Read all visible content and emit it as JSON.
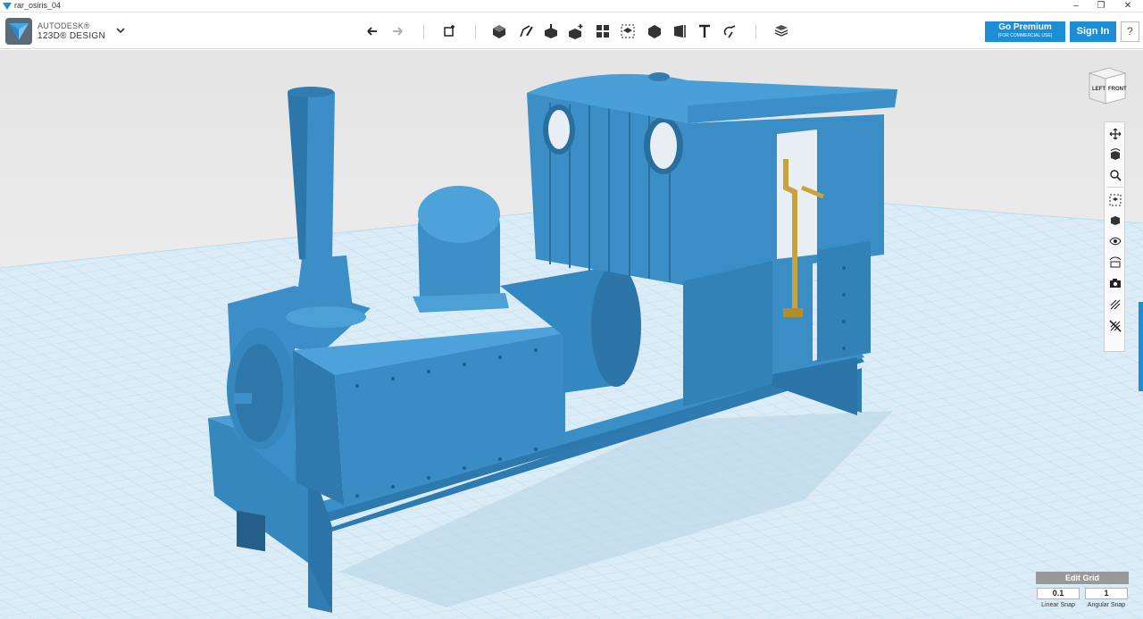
{
  "window": {
    "title": "rar_osiris_04",
    "controls": [
      "minimize",
      "maximize",
      "close"
    ]
  },
  "brand": {
    "company": "AUTODESK®",
    "product": "123D® DESIGN"
  },
  "toolbar": {
    "tools": [
      {
        "name": "undo-icon"
      },
      {
        "name": "redo-icon"
      },
      {
        "name": "transform-icon"
      },
      {
        "name": "primitives-icon"
      },
      {
        "name": "sketch-icon"
      },
      {
        "name": "construct-icon"
      },
      {
        "name": "modify-icon"
      },
      {
        "name": "pattern-icon"
      },
      {
        "name": "grouping-icon"
      },
      {
        "name": "combine-icon"
      },
      {
        "name": "measure-icon"
      },
      {
        "name": "text-icon"
      },
      {
        "name": "snap-icon"
      },
      {
        "name": "material-icon"
      }
    ],
    "premium_label": "Go Premium",
    "premium_sub": "(FOR COMMERCIAL USE)",
    "signin_label": "Sign In",
    "help_label": "?"
  },
  "viewcube": {
    "left": "LEFT",
    "front": "FRONT"
  },
  "navbar": {
    "items": [
      "pan-icon",
      "orbit-icon",
      "zoom-icon",
      "fit-icon",
      "views-icon",
      "visibility-icon",
      "materials-outlines-icon",
      "camera-icon",
      "grid-snap-icon",
      "hide-grid-icon"
    ]
  },
  "grid": {
    "edit_label": "Edit Grid",
    "linear_snap_value": "0.1",
    "linear_snap_label": "Linear Snap",
    "angular_snap_value": "1",
    "angular_snap_label": "Angular Snap"
  },
  "colors": {
    "model": "#3a8ec6",
    "accent": "#1b8ed6",
    "brass": "#c9a23c"
  }
}
